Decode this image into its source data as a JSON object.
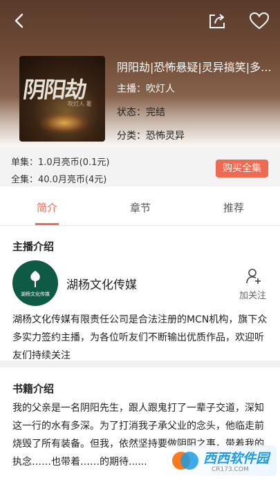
{
  "header": {
    "title": "阴阳劫|恐怖悬疑|灵异搞笑|多...",
    "anchor_label": "主播：",
    "anchor": "吹灯人",
    "status_label": "状态：",
    "status": "完结",
    "category_label": "分类：",
    "category": "恐怖灵异"
  },
  "cover": {
    "title": "阴阳劫",
    "author": "吹灯人 著"
  },
  "pricing": {
    "single": "单集：1.0月亮币(0.1元)",
    "full": "全集：40.0月亮币(4元)",
    "buy_label": "购买全集"
  },
  "tabs": [
    {
      "label": "简介"
    },
    {
      "label": "章节"
    },
    {
      "label": "推荐"
    }
  ],
  "anchor_section": {
    "title": "主播介绍",
    "name": "湖杨文化传媒",
    "avatar_text": "湖杨文化传媒",
    "follow_label": "加关注",
    "description": "湖杨文化传媒有限责任公司是合法注册的MCN机构，旗下众多实力签约主播，为各位听友们不断输出优质作品，欢迎听友们持续关注"
  },
  "book_section": {
    "title": "书籍介绍",
    "description": "我的父亲是一名阴阳先生，跟人跟鬼打了一辈子交道，深知这一行的水有多深。为了打消我子承父业的念头，他临走前烧毁了所有装备。但我，依然坚持要做阴阳之事，带着我的执念……也带着……的期待......"
  },
  "watermark": {
    "text": "西西软件园",
    "url": "CR173.COM"
  },
  "colors": {
    "accent": "#ef6a52",
    "price_bg": "#f3f3f3"
  }
}
